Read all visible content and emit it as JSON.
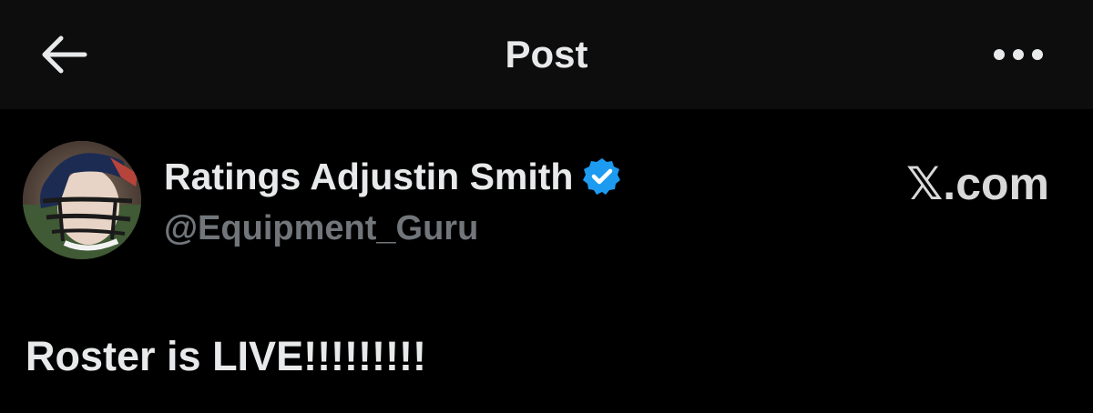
{
  "header": {
    "back_icon": "arrow-left-icon",
    "title": "Post",
    "more_icon": "more-horizontal-icon"
  },
  "post": {
    "author": {
      "display_name": "Ratings Adjustin Smith",
      "handle": "@Equipment_Guru",
      "verified": true,
      "verified_icon": "verified-badge-icon",
      "avatar_icon": "avatar-football-helmet"
    },
    "text": "Roster is LIVE!!!!!!!!!"
  },
  "watermark": "𝕏.com",
  "colors": {
    "background": "#000000",
    "header_background": "#0d0d0d",
    "primary_text": "#e7e9ea",
    "secondary_text": "#71767b",
    "verified_blue": "#1d9bf0"
  }
}
